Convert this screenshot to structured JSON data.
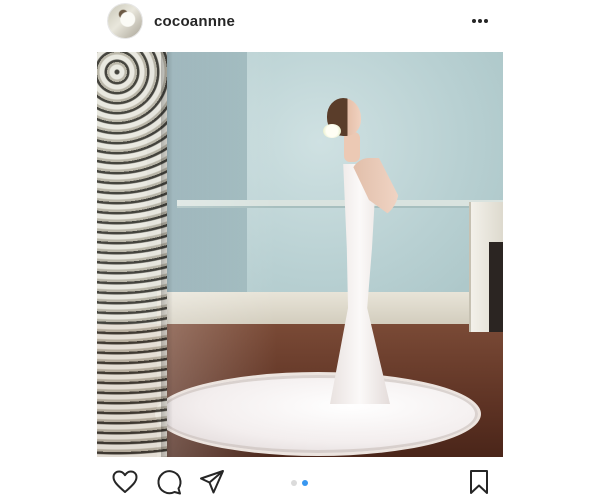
{
  "post": {
    "username": "cocoannne",
    "avatar_icon": "profile-photo",
    "more_icon": "more-horizontal-icon",
    "photo": {
      "description_icon": "wedding-photo",
      "carousel_count": 2,
      "carousel_active_index": 2
    },
    "actions": {
      "like_icon": "heart-icon",
      "comment_icon": "comment-bubble-icon",
      "share_icon": "paper-plane-icon",
      "save_icon": "bookmark-icon"
    },
    "colors": {
      "text": "#262626",
      "active_dot": "#3897f0",
      "inactive_dot": "#dbdbdb",
      "background": "#ffffff"
    }
  }
}
